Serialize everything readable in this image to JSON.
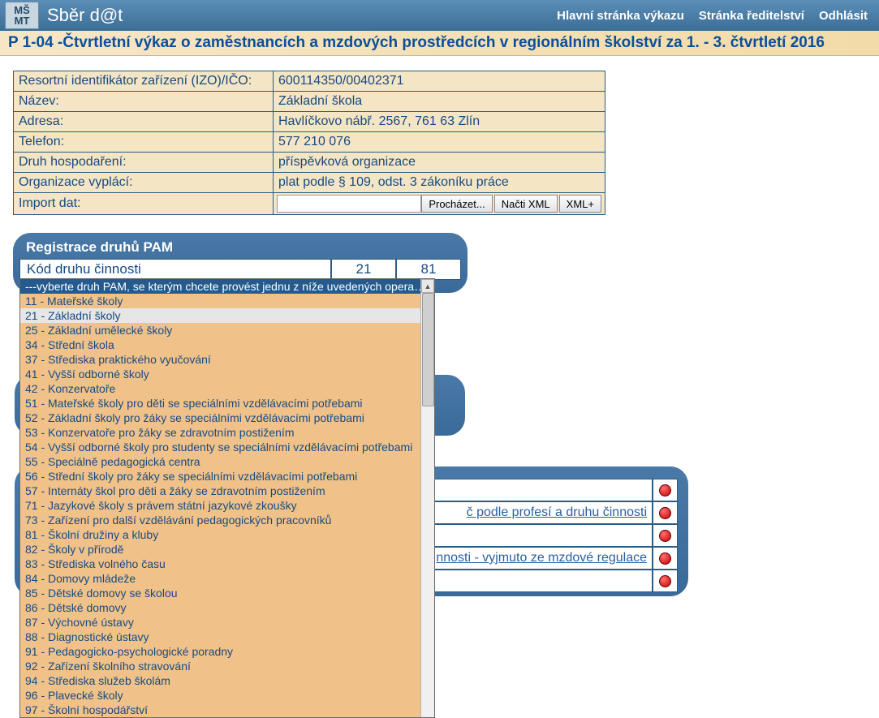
{
  "header": {
    "logo_text": "MŠ\nMT",
    "brand": "Sběr d@t",
    "nav": {
      "home": "Hlavní stránka výkazu",
      "directorate": "Stránka ředitelství",
      "logout": "Odhlásit"
    }
  },
  "page_title": "P 1-04 -Čtvrtletní výkaz o zaměstnancích a mzdových prostředcích v regionálním školství za 1. - 3. čtvrtletí 2016",
  "info": {
    "rows": [
      {
        "label": "Resortní identifikátor zařízení (IZO)/IČO:",
        "value": "600114350/00402371"
      },
      {
        "label": "Název:",
        "value": "Základní škola"
      },
      {
        "label": "Adresa:",
        "value": "Havlíčkovo nábř. 2567, 761 63 Zlín"
      },
      {
        "label": "Telefon:",
        "value": "577 210 076"
      },
      {
        "label": "Druh hospodaření:",
        "value": "příspěvková organizace"
      },
      {
        "label": "Organizace vyplácí:",
        "value": "plat podle § 109, odst. 3 zákoníku práce"
      }
    ],
    "import_label": "Import dat:",
    "browse_btn": "Procházet...",
    "load_btn": "Načti XML",
    "xml_plus_btn": "XML+"
  },
  "pam_panel": {
    "title": "Registrace druhů PAM",
    "header_label": "Kód druhu činnosti",
    "col1": "21",
    "col2": "81",
    "placeholder_opt": "---vyberte druh PAM, se kterým chcete provést jednu z níže uvedených operací---",
    "options": [
      "11 - Mateřské školy",
      "21 - Základní školy",
      "25 - Základní umělecké školy",
      "34 - Střední škola",
      "37 - Střediska praktického vyučování",
      "41 - Vyšší odborné školy",
      "42 - Konzervatoře",
      "51 - Mateřské školy pro děti se speciálními vzdělávacími potřebami",
      "52 - Základní školy pro žáky se speciálními vzdělávacími potřebami",
      "53 - Konzervatoře pro žáky se zdravotním postižením",
      "54 - Vyšší odborné školy pro studenty se speciálními vzdělávacími potřebami",
      "55 - Speciálně pedagogická centra",
      "56 - Střední školy pro žáky se speciálními vzdělávacími potřebami",
      "57 - Internáty škol pro děti a žáky se zdravotním postižením",
      "71 - Jazykové školy s právem státní jazykové zkoušky",
      "73 - Zařízení pro další vzdělávání pedagogických pracovníků",
      "81 - Školní družiny a kluby",
      "82 - Školy v přírodě",
      "83 - Střediska volného času",
      "84 - Domovy mládeže",
      "85 - Dětské domovy se školou",
      "86 - Dětské domovy",
      "87 - Výchovné ústavy",
      "88 - Diagnostické ústavy",
      "91 - Pedagogicko-psychologické poradny",
      "92 - Zařízení školního stravování",
      "94 - Střediska služeb školám",
      "96 - Plavecké školy",
      "97 - Školní hospodářství"
    ]
  },
  "sections": {
    "r2_tail": "č podle profesí a druhu činnosti",
    "r4_tail": "nnosti - vyjmuto ze mzdové regulace"
  }
}
